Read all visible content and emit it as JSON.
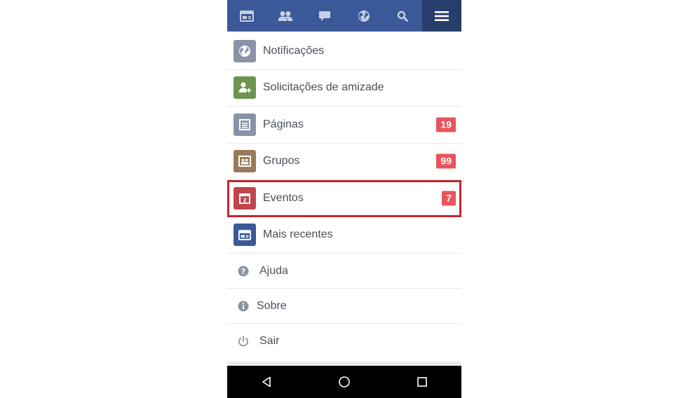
{
  "topbar": {
    "tabs": [
      {
        "icon": "news-feed-icon"
      },
      {
        "icon": "friends-icon"
      },
      {
        "icon": "messages-icon"
      },
      {
        "icon": "globe-icon"
      },
      {
        "icon": "search-icon"
      },
      {
        "icon": "menu-icon",
        "active": true
      }
    ],
    "color": "#3b5998"
  },
  "menu": {
    "items": [
      {
        "label": "Notificações",
        "icon": "globe-icon",
        "tile_color": "#8a93a6"
      },
      {
        "label": "Solicitações de amizade",
        "icon": "add-friend-icon",
        "tile_color": "#6e9550"
      },
      {
        "label": "Páginas",
        "icon": "pages-icon",
        "tile_color": "#8a93a6",
        "badge": "19"
      },
      {
        "label": "Grupos",
        "icon": "groups-icon",
        "tile_color": "#9a7a5a",
        "badge": "99"
      },
      {
        "label": "Eventos",
        "icon": "calendar-icon",
        "tile_color": "#c0464c",
        "badge": "7",
        "highlighted": true
      },
      {
        "label": "Mais recentes",
        "icon": "news-feed-icon",
        "tile_color": "#3b5998"
      },
      {
        "label": "Ajuda",
        "icon": "help-icon"
      },
      {
        "label": "Sobre",
        "icon": "info-icon"
      },
      {
        "label": "Sair",
        "icon": "power-icon"
      }
    ],
    "badge_color": "#e9545c",
    "highlight_color": "#c0262e"
  },
  "navbar": {
    "buttons": [
      {
        "icon": "back-icon"
      },
      {
        "icon": "home-icon"
      },
      {
        "icon": "recent-apps-icon"
      }
    ]
  }
}
